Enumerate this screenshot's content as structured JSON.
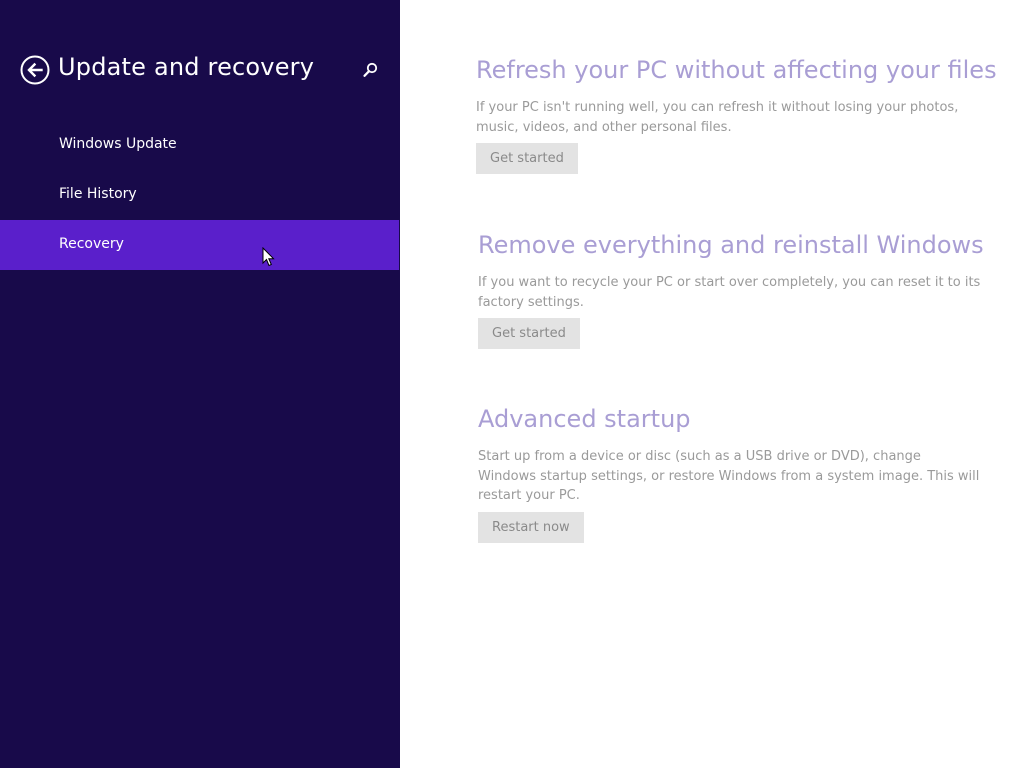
{
  "header": {
    "title": "Update and recovery",
    "back_icon": "back-arrow-icon",
    "search_icon": "search-icon"
  },
  "sidebar": {
    "items": [
      {
        "label": "Windows Update",
        "active": false
      },
      {
        "label": "File History",
        "active": false
      },
      {
        "label": "Recovery",
        "active": true
      }
    ]
  },
  "sections": [
    {
      "title": "Refresh your PC without affecting your files",
      "description": "If your PC isn't running well, you can refresh it without losing your photos, music, videos, and other personal files.",
      "button": "Get started"
    },
    {
      "title": "Remove everything and reinstall Windows",
      "description": "If you want to recycle your PC or start over completely, you can reset it to its factory settings.",
      "button": "Get started"
    },
    {
      "title": "Advanced startup",
      "description": "Start up from a device or disc (such as a USB drive or DVD), change Windows startup settings, or restore Windows from a system image. This will restart your PC.",
      "button": "Restart now"
    }
  ],
  "colors": {
    "sidebar_bg": "#180a4a",
    "sidebar_active": "#5a1fcb",
    "section_title": "#a99ed4",
    "button_bg": "#e3e3e3"
  }
}
